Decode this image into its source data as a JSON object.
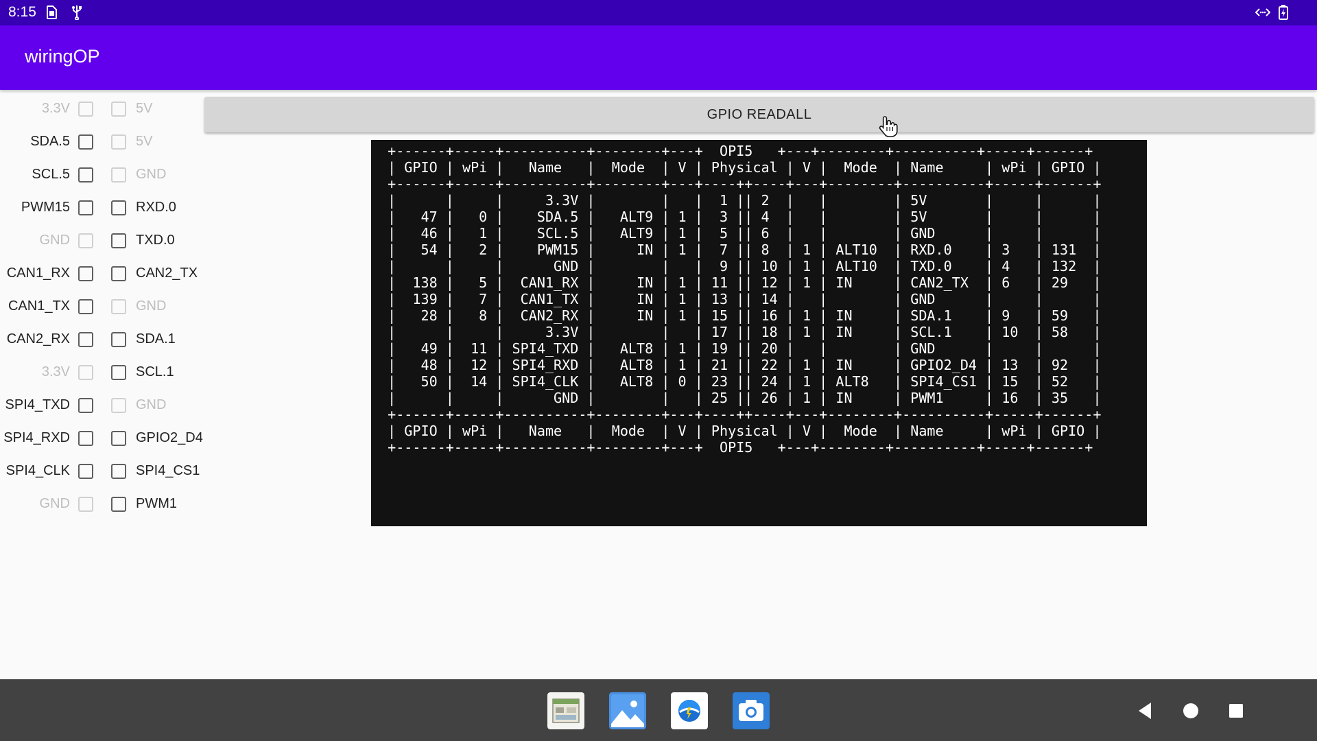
{
  "status_bar": {
    "time": "8:15"
  },
  "app_title": "wiringOP",
  "pins": [
    {
      "left": "3.3V",
      "left_enabled": false,
      "right": "5V",
      "right_enabled": false
    },
    {
      "left": "SDA.5",
      "left_enabled": true,
      "right": "5V",
      "right_enabled": false
    },
    {
      "left": "SCL.5",
      "left_enabled": true,
      "right": "GND",
      "right_enabled": false
    },
    {
      "left": "PWM15",
      "left_enabled": true,
      "right": "RXD.0",
      "right_enabled": true
    },
    {
      "left": "GND",
      "left_enabled": false,
      "right": "TXD.0",
      "right_enabled": true
    },
    {
      "left": "CAN1_RX",
      "left_enabled": true,
      "right": "CAN2_TX",
      "right_enabled": true
    },
    {
      "left": "CAN1_TX",
      "left_enabled": true,
      "right": "GND",
      "right_enabled": false
    },
    {
      "left": "CAN2_RX",
      "left_enabled": true,
      "right": "SDA.1",
      "right_enabled": true
    },
    {
      "left": "3.3V",
      "left_enabled": false,
      "right": "SCL.1",
      "right_enabled": true
    },
    {
      "left": "SPI4_TXD",
      "left_enabled": true,
      "right": "GND",
      "right_enabled": false
    },
    {
      "left": "SPI4_RXD",
      "left_enabled": true,
      "right": "GPIO2_D4",
      "right_enabled": true
    },
    {
      "left": "SPI4_CLK",
      "left_enabled": true,
      "right": "SPI4_CS1",
      "right_enabled": true
    },
    {
      "left": "GND",
      "left_enabled": false,
      "right": "PWM1",
      "right_enabled": true
    }
  ],
  "readall_button": "GPIO READALL",
  "terminal_lines": [
    " +------+-----+----------+--------+---+  OPI5   +---+--------+----------+-----+------+",
    " | GPIO | wPi |   Name   |  Mode  | V | Physical | V |  Mode  | Name     | wPi | GPIO |",
    " +------+-----+----------+--------+---+----++----+---+--------+----------+-----+------+",
    " |      |     |     3.3V |        |   |  1 || 2  |   |        | 5V       |     |      |",
    " |   47 |   0 |    SDA.5 |   ALT9 | 1 |  3 || 4  |   |        | 5V       |     |      |",
    " |   46 |   1 |    SCL.5 |   ALT9 | 1 |  5 || 6  |   |        | GND      |     |      |",
    " |   54 |   2 |    PWM15 |     IN | 1 |  7 || 8  | 1 | ALT10  | RXD.0    | 3   | 131  |",
    " |      |     |      GND |        |   |  9 || 10 | 1 | ALT10  | TXD.0    | 4   | 132  |",
    " |  138 |   5 |  CAN1_RX |     IN | 1 | 11 || 12 | 1 | IN     | CAN2_TX  | 6   | 29   |",
    " |  139 |   7 |  CAN1_TX |     IN | 1 | 13 || 14 |   |        | GND      |     |      |",
    " |   28 |   8 |  CAN2_RX |     IN | 1 | 15 || 16 | 1 | IN     | SDA.1    | 9   | 59   |",
    " |      |     |     3.3V |        |   | 17 || 18 | 1 | IN     | SCL.1    | 10  | 58   |",
    " |   49 |  11 | SPI4_TXD |   ALT8 | 1 | 19 || 20 |   |        | GND      |     |      |",
    " |   48 |  12 | SPI4_RXD |   ALT8 | 1 | 21 || 22 | 1 | IN     | GPIO2_D4 | 13  | 92   |",
    " |   50 |  14 | SPI4_CLK |   ALT8 | 0 | 23 || 24 | 1 | ALT8   | SPI4_CS1 | 15  | 52   |",
    " |      |     |      GND |        |   | 25 || 26 | 1 | IN     | PWM1     | 16  | 35   |",
    " +------+-----+----------+--------+---+----++----+---+--------+----------+-----+------+",
    " | GPIO | wPi |   Name   |  Mode  | V | Physical | V |  Mode  | Name     | wPi | GPIO |",
    " +------+-----+----------+--------+---+  OPI5   +---+--------+----------+-----+------+"
  ],
  "icons": {
    "status": [
      "sim-card-icon",
      "usb-icon",
      "data-sync-icon",
      "battery-charging-icon"
    ],
    "dock": [
      "gallery-app-icon",
      "photos-app-icon",
      "browser-app-icon",
      "camera-app-icon"
    ],
    "nav": [
      "back-icon",
      "home-icon",
      "recents-icon"
    ],
    "cursor": "hand-pointer-icon"
  },
  "colors": {
    "status_bar": "#3700b3",
    "app_bar": "#6200ee",
    "terminal_bg": "#121212",
    "nav_bar": "#424242"
  }
}
